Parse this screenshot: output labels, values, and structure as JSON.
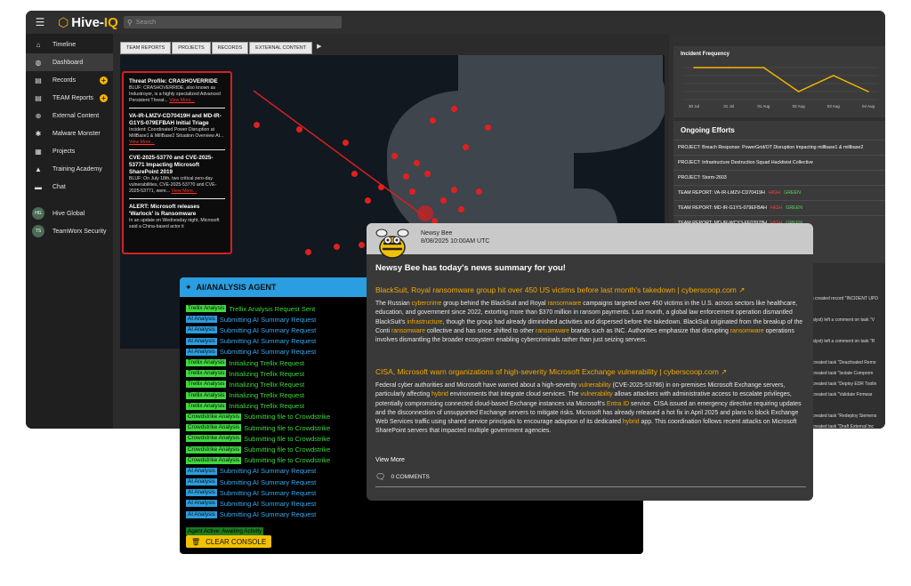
{
  "app": {
    "logo_text": "Hive-",
    "logo_accent": "IQ",
    "search_placeholder": "Search"
  },
  "sidebar": {
    "items": [
      {
        "label": "Timeline",
        "icon": "home-icon",
        "glyph": "⌂"
      },
      {
        "label": "Dashboard",
        "icon": "globe-icon",
        "glyph": "◍"
      },
      {
        "label": "Records",
        "icon": "records-icon",
        "glyph": "▤"
      },
      {
        "label": "TEAM Reports",
        "icon": "report-icon",
        "glyph": "▤"
      },
      {
        "label": "External Content",
        "icon": "globe-icon",
        "glyph": "⊕"
      },
      {
        "label": "Malware Monster",
        "icon": "bug-icon",
        "glyph": "✱"
      },
      {
        "label": "Projects",
        "icon": "projects-icon",
        "glyph": "▦"
      },
      {
        "label": "Training Academy",
        "icon": "graduation-icon",
        "glyph": "▲"
      },
      {
        "label": "Chat",
        "icon": "chat-icon",
        "glyph": "▬"
      }
    ],
    "orgs": [
      {
        "label": "Hive Global",
        "initials": "HG"
      },
      {
        "label": "TeamWorx Security",
        "initials": "TS"
      }
    ]
  },
  "tabs": [
    "TEAM REPORTS",
    "PROJECTS",
    "RECORDS",
    "EXTERNAL CONTENT"
  ],
  "threats": [
    {
      "title": "Threat Profile: CRASHOVERRIDE",
      "body": "BLUF: CRASHOVERRIDE, also known as Industroyer, is a highly specialized Advanced Persistent Threat...",
      "more": "View More..."
    },
    {
      "title": "VA-IR-LMZV-CD70419H and MD-IR-G1YS-079EFBAH Initial Triage",
      "body": "Incident: Coordinated Power Disruption at MillBase1 & MillBase2 Situation Overview At...",
      "more": "View More..."
    },
    {
      "title": "CVE-2025-53770 and CVE-2025-53771 Impacting Microsoft SharePoint 2019",
      "body": "BLUF: On July 18th, two critical zero-day vulnerabilities, CVE-2025-53770 and CVE-2025-53771, were...",
      "more": "View More..."
    },
    {
      "title": "ALERT: Microsoft releases 'Warlock' is Ransomware",
      "body": "In an update on Wednesday night, Microsoft said a China-based actor it",
      "more": ""
    }
  ],
  "incident": {
    "title": "Incident Frequency",
    "x_labels": [
      "30 Jul",
      "31 Jul",
      "01 Aug",
      "02 Aug",
      "03 Aug",
      "04 Aug"
    ]
  },
  "chart_data": {
    "type": "line",
    "title": "Incident Frequency",
    "x": [
      "30 Jul",
      "31 Jul",
      "01 Aug",
      "02 Aug",
      "03 Aug",
      "04 Aug"
    ],
    "values": [
      4,
      4,
      4,
      1,
      3,
      1
    ],
    "grid": true,
    "color": "#f2b400"
  },
  "efforts": {
    "title": "Ongoing Efforts",
    "rows": [
      {
        "text": "PROJECT: Breach Response: PowerGrid/OT Disruption Impacting millbase1 & millbase2",
        "high": "",
        "green": ""
      },
      {
        "text": "PROJECT: Infrastructure Destruction Squad Hacktivist Collective",
        "high": "",
        "green": ""
      },
      {
        "text": "PROJECT: Storm-2603",
        "high": "",
        "green": ""
      },
      {
        "text": "TEAM REPORT: VA-IR-LMZV-CD70419H",
        "high": "HIGH",
        "green": "GREEN"
      },
      {
        "text": "TEAM REPORT: MD-IR-G1YS-079EFBAH",
        "high": "HIGH",
        "green": "GREEN"
      },
      {
        "text": "TEAM REPORT: MD-IR-WCY3-FE03978H",
        "high": "HIGH",
        "green": "GREEN"
      }
    ]
  },
  "activity": [
    ") created record \"INCIDENT UPD",
    "",
    "alyst) left a comment on task \"V",
    "",
    "alyst) left a comment on task \"R",
    "",
    "created task \"Deactivated Remo",
    "created task \"Isolate Comprom",
    "created task \"Deploy EDR Toolin",
    "created task \"Validate Firmwar",
    "",
    "created task \"Redeploy Siemens",
    "created task \"Draft External Inc"
  ],
  "agent": {
    "title": "AI/ANALYSIS AGENT",
    "log": [
      {
        "tag": "Trellix Analysis",
        "msg": "Trellix Analysis Request Sent",
        "kind": "trellix"
      },
      {
        "tag": "AI Analysis",
        "msg": "Submitting AI Summary Request",
        "kind": "ai"
      },
      {
        "tag": "AI Analysis",
        "msg": "Submitting AI Summary Request",
        "kind": "ai"
      },
      {
        "tag": "AI Analysis",
        "msg": "Submitting AI Summary Request",
        "kind": "ai"
      },
      {
        "tag": "AI Analysis",
        "msg": "Submitting AI Summary Request",
        "kind": "ai"
      },
      {
        "tag": "Trellix Analysis",
        "msg": "Initializing Trellix Request",
        "kind": "trellix"
      },
      {
        "tag": "Trellix Analysis",
        "msg": "Initializing Trellix Request",
        "kind": "trellix"
      },
      {
        "tag": "Trellix Analysis",
        "msg": "Initializing Trellix Request",
        "kind": "trellix"
      },
      {
        "tag": "Trellix Analysis",
        "msg": "Initializing Trellix Request",
        "kind": "trellix"
      },
      {
        "tag": "Trellix Analysis",
        "msg": "Initializing Trellix Request",
        "kind": "trellix"
      },
      {
        "tag": "Crowdstrike Analysis",
        "msg": "Submitting file to Crowdstrike",
        "kind": "crowd"
      },
      {
        "tag": "Crowdstrike Analysis",
        "msg": "Submitting file to Crowdstrike",
        "kind": "crowd"
      },
      {
        "tag": "Crowdstrike Analysis",
        "msg": "Submitting file to Crowdstrike",
        "kind": "crowd"
      },
      {
        "tag": "Crowdstrike Analysis",
        "msg": "Submitting file to Crowdstrike",
        "kind": "crowd"
      },
      {
        "tag": "Crowdstrike Analysis",
        "msg": "Submitting file to Crowdstrike",
        "kind": "crowd"
      },
      {
        "tag": "AI Analysis",
        "msg": "Submitting AI Summary Request",
        "kind": "ai"
      },
      {
        "tag": "AI Analysis",
        "msg": "Submitting AI Summary Request",
        "kind": "ai"
      },
      {
        "tag": "AI Analysis",
        "msg": "Submitting AI Summary Request",
        "kind": "ai"
      },
      {
        "tag": "AI Analysis",
        "msg": "Submitting AI Summary Request",
        "kind": "ai"
      },
      {
        "tag": "AI Analysis",
        "msg": "Submitting AI Summary Request",
        "kind": "ai"
      }
    ],
    "status": "Agent Active: Awaiting Activity",
    "clear_label": "CLEAR CONSOLE"
  },
  "news": {
    "author": "Newsy Bee",
    "date": "8/08/2025 10:00AM UTC",
    "headline": "Newsy Bee has today's news summary for you!",
    "articles": [
      {
        "title": "BlackSuit, Royal ransomware group hit over 450 US victims before last month's takedown",
        "source": " | cyberscoop.com ↗",
        "parts": [
          [
            "The Russian ",
            false
          ],
          [
            "cybercrime",
            true
          ],
          [
            " group behind the BlackSuit and Royal ",
            false
          ],
          [
            "ransomware",
            true
          ],
          [
            " campaigns targeted over 450 victims in the U.S. across sectors like healthcare, education, and government since 2022, extorting more than $370 million in ransom payments. Last month, a global law enforcement operation dismantled BlackSuit's ",
            false
          ],
          [
            "infrastructure",
            true
          ],
          [
            ", though the group had already diminished activities and dispersed before the takedown. BlackSuit originated from the breakup of the Conti ",
            false
          ],
          [
            "ransomware",
            true
          ],
          [
            " collective and has since shifted to other ",
            false
          ],
          [
            "ransomware",
            true
          ],
          [
            " brands such as INC. Authorities emphasize that disrupting ",
            false
          ],
          [
            "ransomware",
            true
          ],
          [
            " operations involves dismantling the broader ecosystem enabling cybercriminals rather than just seizing servers.",
            false
          ]
        ]
      },
      {
        "title": "CISA, Microsoft warn organizations of high-severity Microsoft Exchange vulnerability",
        "source": " | cyberscoop.com ↗",
        "parts": [
          [
            "Federal cyber authorities and Microsoft have warned about a high-severity ",
            false
          ],
          [
            "vulnerability",
            true
          ],
          [
            " (CVE-2025-53786) in on-premises Microsoft Exchange servers, particularly affecting ",
            false
          ],
          [
            "hybrid",
            true
          ],
          [
            " environments that integrate cloud services. The ",
            false
          ],
          [
            "vulnerability",
            true
          ],
          [
            " allows attackers with administrative access to escalate privileges, potentially compromising connected cloud-based Exchange instances via Microsoft's ",
            false
          ],
          [
            "Entra ID",
            true
          ],
          [
            " service. CISA issued an emergency directive requiring updates and the disconnection of unsupported Exchange servers to mitigate risks. Microsoft has already released a hot fix in April 2025 and plans to block Exchange Web Services traffic using shared service principals to encourage adoption of its dedicated ",
            false
          ],
          [
            "hybrid",
            true
          ],
          [
            " app. This coordination follows recent attacks on Microsoft SharePoint servers that impacted multiple government agencies.",
            false
          ]
        ]
      }
    ],
    "view_more": "View More",
    "comments": "0 COMMENTS"
  }
}
